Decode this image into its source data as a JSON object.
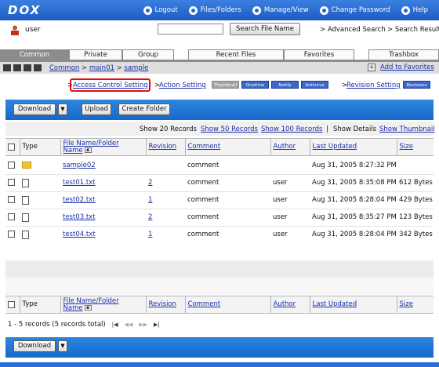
{
  "app": {
    "logo": "DOX"
  },
  "topnav": [
    {
      "label": "Logout",
      "name": "logout"
    },
    {
      "label": "Files/Folders",
      "name": "files-folders"
    },
    {
      "label": "Manage/View",
      "name": "manage-view"
    },
    {
      "label": "Change Password",
      "name": "change-password"
    },
    {
      "label": "Help",
      "name": "help"
    }
  ],
  "user": {
    "name": "user"
  },
  "search": {
    "value": "",
    "button": "Search File Name",
    "advanced": "> Advanced Search",
    "results": "> Search Result"
  },
  "tabs": [
    "Common",
    "Private",
    "Group",
    "Recent Files",
    "Favorites",
    "Trashbox"
  ],
  "breadcrumb": {
    "items": [
      "Common",
      "main01",
      "sample"
    ],
    "sep": ">"
  },
  "favorites": {
    "add": "Add to Favorites"
  },
  "settings": {
    "access": "Access Control Setting",
    "action": "Action Setting",
    "badges": [
      "Thumbnail",
      "Onetime",
      "Notify",
      "Antivirus"
    ],
    "revision": "Revision Setting",
    "revision_badge": "Revisions"
  },
  "toolbar": {
    "download": "Download",
    "upload": "Upload",
    "create_folder": "Create Folder"
  },
  "records": {
    "show20": "Show 20 Records",
    "show50": "Show 50 Records",
    "show100": "Show 100 Records",
    "sep": "|",
    "details": "Show Details",
    "thumbnail": "Show Thumbnail"
  },
  "columns": {
    "type": "Type",
    "name1": "File Name/Folder",
    "name2": "Name",
    "revision": "Revision",
    "comment": "Comment",
    "author": "Author",
    "updated": "Last Updated",
    "size": "Size"
  },
  "rows": [
    {
      "kind": "folder",
      "name": "sample02",
      "revision": "",
      "comment": "comment",
      "author": "",
      "updated": "Aug 31, 2005 8:27:32 PM",
      "size": ""
    },
    {
      "kind": "file",
      "name": "test01.txt",
      "revision": "2",
      "comment": "comment",
      "author": "user",
      "updated": "Aug 31, 2005 8:35:08 PM",
      "size": "612 Bytes"
    },
    {
      "kind": "file",
      "name": "test02.txt",
      "revision": "1",
      "comment": "comment",
      "author": "user",
      "updated": "Aug 31, 2005 8:28:04 PM",
      "size": "429 Bytes"
    },
    {
      "kind": "file",
      "name": "test03.txt",
      "revision": "2",
      "comment": "comment",
      "author": "user",
      "updated": "Aug 31, 2005 8:35:27 PM",
      "size": "123 Bytes"
    },
    {
      "kind": "file",
      "name": "test04.txt",
      "revision": "1",
      "comment": "comment",
      "author": "user",
      "updated": "Aug 31, 2005 8:28:04 PM",
      "size": "342 Bytes"
    }
  ],
  "pager": {
    "summary": "1 - 5 records (5 records total)",
    "first": "|◀",
    "prev": "◀◀",
    "next": "▶▶",
    "last": "▶|"
  },
  "footer": {
    "download": "Download"
  },
  "colors": {
    "accent": "#1e5cc4",
    "highlight": "#e01010"
  }
}
